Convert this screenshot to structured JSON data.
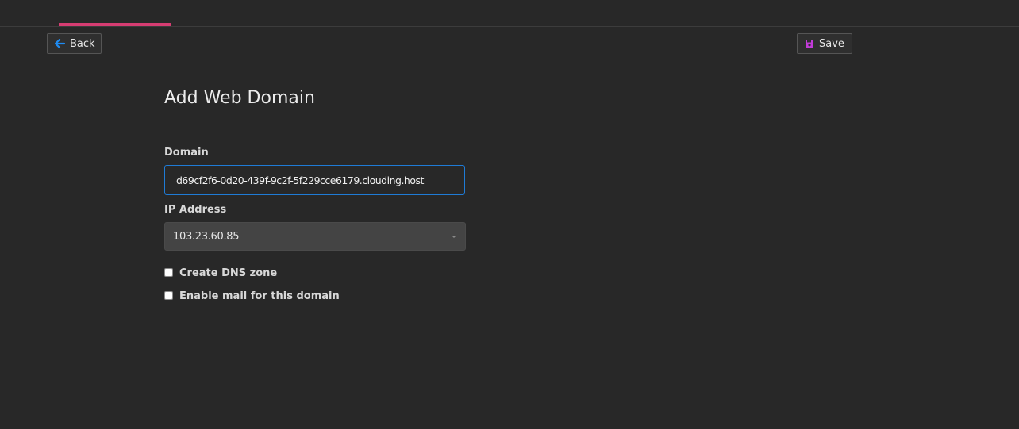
{
  "toolbar": {
    "back_label": "Back",
    "back_icon": "arrow-left-icon",
    "save_label": "Save",
    "save_icon": "floppy-disk-icon"
  },
  "page": {
    "title": "Add Web Domain"
  },
  "form": {
    "domain_label": "Domain",
    "domain_value": "d69cf2f6-0d20-439f-9c2f-5f229cce6179.clouding.host",
    "ip_label": "IP Address",
    "ip_value": "103.23.60.85",
    "create_dns_label": "Create DNS zone",
    "create_dns_checked": false,
    "enable_mail_label": "Enable mail for this domain",
    "enable_mail_checked": false
  },
  "colors": {
    "background": "#282828",
    "accent_tab": "#d63d72",
    "back_icon": "#1f8bf2",
    "save_icon": "#c13bd8",
    "focus_border": "#1f7bd6"
  }
}
